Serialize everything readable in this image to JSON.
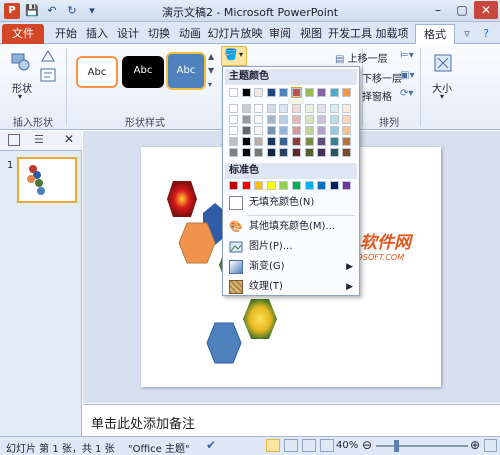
{
  "window": {
    "title": "演示文稿2 - Microsoft PowerPoint",
    "app_icon": "P"
  },
  "tabs": [
    "文件",
    "开始",
    "插入",
    "设计",
    "切换",
    "动画",
    "幻灯片放映",
    "审阅",
    "视图",
    "开发工具",
    "加载项",
    "格式"
  ],
  "ribbon": {
    "insert_shapes": {
      "label": "形状",
      "group_label": "插入形状"
    },
    "shape_styles": {
      "group_label": "形状样式",
      "style_labels": [
        "Abc",
        "Abc",
        "Abc"
      ]
    },
    "arrange": {
      "group_label": "排列",
      "bring_forward": "上移一层",
      "send_backward": "下移一层",
      "selection_pane": "择窗格"
    },
    "size": {
      "label": "大小"
    }
  },
  "fill_menu": {
    "theme_colors_header": "主题颜色",
    "standard_colors_header": "标准色",
    "no_fill": "无填充颜色(N)",
    "more_colors": "其他填充颜色(M)...",
    "picture": "图片(P)...",
    "gradient": "渐变(G)",
    "texture": "纹理(T)",
    "theme_top_row": [
      "#ffffff",
      "#000000",
      "#eeece1",
      "#1f497d",
      "#4f81bd",
      "#c0504d",
      "#9bbb59",
      "#8064a2",
      "#4bacc6",
      "#f79646"
    ],
    "standard_row": [
      "#c00000",
      "#ff0000",
      "#ffc000",
      "#ffff00",
      "#92d050",
      "#00b050",
      "#00b0f0",
      "#0070c0",
      "#002060",
      "#7030a0"
    ]
  },
  "slide_panel": {
    "slide_number": "1"
  },
  "notes": {
    "placeholder": "单击此处添加备注"
  },
  "status": {
    "slide_info": "幻灯片 第 1 张，共 1 张",
    "theme": "\"Office 主题\"",
    "zoom": "40%"
  },
  "watermark": {
    "main": "第九软件网",
    "sub": "WWW.D9SOFT.COM"
  }
}
